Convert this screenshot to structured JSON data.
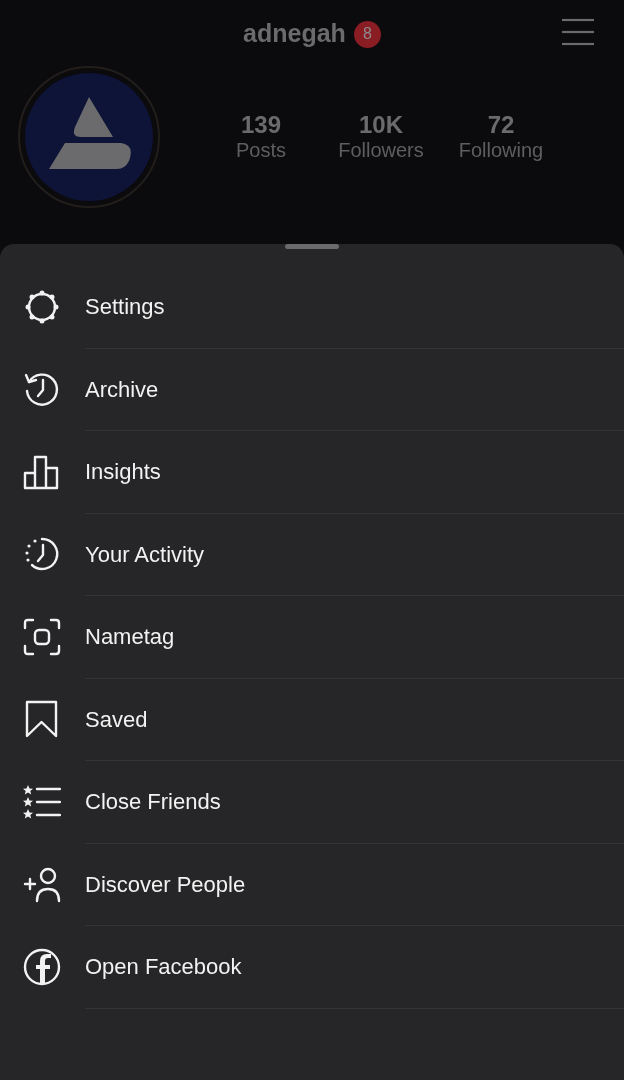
{
  "header": {
    "username": "adnegah",
    "notification_count": "8"
  },
  "stats": [
    {
      "value": "139",
      "label": "Posts"
    },
    {
      "value": "10K",
      "label": "Followers"
    },
    {
      "value": "72",
      "label": "Following"
    }
  ],
  "menu": [
    {
      "label": "Settings"
    },
    {
      "label": "Archive"
    },
    {
      "label": "Insights"
    },
    {
      "label": "Your Activity"
    },
    {
      "label": "Nametag"
    },
    {
      "label": "Saved"
    },
    {
      "label": "Close Friends"
    },
    {
      "label": "Discover People"
    },
    {
      "label": "Open Facebook"
    }
  ]
}
